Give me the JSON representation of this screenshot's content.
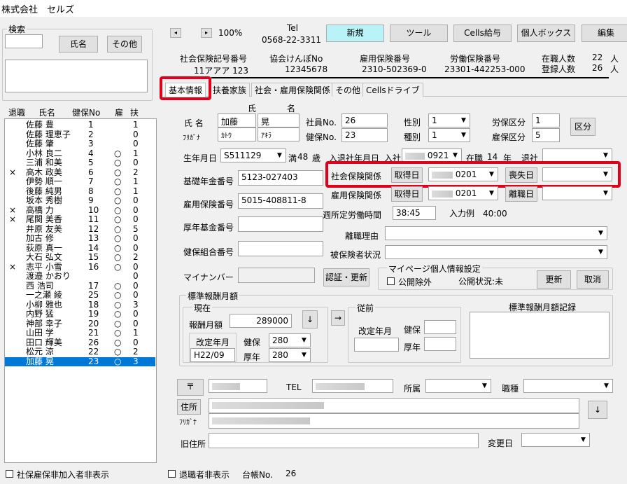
{
  "window": {
    "title": "株式会社　セルズ"
  },
  "search": {
    "group_label": "検索",
    "btn_name": "氏名",
    "btn_other": "その他"
  },
  "list": {
    "headers": {
      "retired": "退職",
      "name": "氏名",
      "no": "健保No",
      "employ": "雇",
      "dependents": "扶"
    },
    "rows": [
      {
        "retired": "",
        "name": "佐藤 豊",
        "no": "1",
        "employ": "",
        "dep": "1"
      },
      {
        "retired": "",
        "name": "佐藤 理恵子",
        "no": "2",
        "employ": "",
        "dep": "0"
      },
      {
        "retired": "",
        "name": "佐藤 肇",
        "no": "3",
        "employ": "",
        "dep": "0"
      },
      {
        "retired": "",
        "name": "小林 良二",
        "no": "4",
        "employ": "○",
        "dep": "1"
      },
      {
        "retired": "",
        "name": "三浦 和美",
        "no": "5",
        "employ": "○",
        "dep": "0"
      },
      {
        "retired": "×",
        "name": "高木 政美",
        "no": "6",
        "employ": "○",
        "dep": "2"
      },
      {
        "retired": "",
        "name": "伊勢 順一",
        "no": "7",
        "employ": "○",
        "dep": "1"
      },
      {
        "retired": "",
        "name": "後藤 純男",
        "no": "8",
        "employ": "○",
        "dep": "1"
      },
      {
        "retired": "",
        "name": "坂本 秀樹",
        "no": "9",
        "employ": "○",
        "dep": "0"
      },
      {
        "retired": "×",
        "name": "高橋 力",
        "no": "10",
        "employ": "○",
        "dep": "0"
      },
      {
        "retired": "×",
        "name": "尾関 美香",
        "no": "11",
        "employ": "○",
        "dep": "0"
      },
      {
        "retired": "",
        "name": "井原 友美",
        "no": "12",
        "employ": "○",
        "dep": "5"
      },
      {
        "retired": "",
        "name": "加古 修",
        "no": "13",
        "employ": "○",
        "dep": "0"
      },
      {
        "retired": "",
        "name": "荻原 真一",
        "no": "14",
        "employ": "○",
        "dep": "0"
      },
      {
        "retired": "",
        "name": "大石 弘文",
        "no": "15",
        "employ": "○",
        "dep": "2"
      },
      {
        "retired": "×",
        "name": "志平 小雪",
        "no": "16",
        "employ": "○",
        "dep": "0"
      },
      {
        "retired": "",
        "name": "渡邉 かおり",
        "no": "",
        "employ": "",
        "dep": "0"
      },
      {
        "retired": "",
        "name": "西 浩司",
        "no": "17",
        "employ": "○",
        "dep": "0"
      },
      {
        "retired": "",
        "name": "一之瀬 綾",
        "no": "25",
        "employ": "○",
        "dep": "0"
      },
      {
        "retired": "",
        "name": "小柳 雅也",
        "no": "18",
        "employ": "○",
        "dep": "3"
      },
      {
        "retired": "",
        "name": "内野 猛",
        "no": "19",
        "employ": "○",
        "dep": "0"
      },
      {
        "retired": "",
        "name": "神部 幸子",
        "no": "20",
        "employ": "○",
        "dep": "0"
      },
      {
        "retired": "",
        "name": "山田 学",
        "no": "21",
        "employ": "○",
        "dep": "1"
      },
      {
        "retired": "",
        "name": "田口 輝美",
        "no": "26",
        "employ": "○",
        "dep": "0"
      },
      {
        "retired": "",
        "name": "松元 涼",
        "no": "22",
        "employ": "○",
        "dep": "2"
      },
      {
        "retired": "",
        "name": "加藤 晃",
        "no": "23",
        "employ": "○",
        "dep": "3",
        "selected": true
      }
    ]
  },
  "bottom": {
    "hide_unenrolled": "社保雇保非加入者非表示",
    "hide_retired": "退職者非表示",
    "ledger_label": "台帳No.",
    "ledger_no": "26"
  },
  "toolbar": {
    "zoom": "100%",
    "tel_label": "Tel",
    "tel": "0568-22-3311",
    "new": "新規",
    "tool": "ツール",
    "cells_pay": "Cells給与",
    "personal_box": "個人ボックス",
    "edit": "編集"
  },
  "header": {
    "sh_label": "社会保険記号番号",
    "sh_value": "11アアア 123",
    "kyokai_label": "協会けんぽNo",
    "kyokai_value": "12345678",
    "koyo_label": "雇用保険番号",
    "koyo_value": "2310-502369-0",
    "rodo_label": "労働保険番号",
    "rodo_value": "23301-442253-000",
    "zaishoku_label": "在職人数",
    "zaishoku_value": "22",
    "toroku_label": "登録人数",
    "toroku_value": "26",
    "unit": "人"
  },
  "tabs": [
    "基本情報",
    "扶養家族",
    "社会・雇用保険関係",
    "その他",
    "Cellsドライブ"
  ],
  "form": {
    "shi": "氏",
    "mei": "名",
    "name_label": "氏 名",
    "furigana_label": "ﾌﾘｶﾞﾅ",
    "last_name": "加藤",
    "first_name": "晃",
    "last_kana": "ｶﾄｳ",
    "first_kana": "ｱｷﾗ",
    "emp_no_label": "社員No.",
    "emp_no": "26",
    "kenpo_no_label": "健保No.",
    "kenpo_no": "23",
    "gender_label": "性別",
    "gender": "1",
    "type_label": "種別",
    "type": "1",
    "rodo_kubun_label": "労保区分",
    "rodo_kubun": "1",
    "koyo_kubun_label": "雇保区分",
    "koyo_kubun": "5",
    "kubun_btn": "区分",
    "birth_label": "生年月日",
    "birth": "S511129",
    "age_prefix": "満",
    "age": "48",
    "age_suffix": "歳",
    "join_label": "入退社年月日",
    "join_in": "入社",
    "join_date": "0921",
    "tenure_label": "在職",
    "tenure": "14",
    "tenure_unit": "年",
    "retire_label": "退社",
    "pension_label": "基礎年金番号",
    "pension": "5123-027403",
    "shaho_label": "社会保険関係",
    "get_btn": "取得日",
    "shaho_date": "0201",
    "lose_btn": "喪失日",
    "koyo_label": "雇用保険番号",
    "koyo": "5015-408811-8",
    "koyo_rel_label": "雇用保険関係",
    "koyo_date": "0201",
    "leave_btn": "離職日",
    "hours_label": "週所定労働時間",
    "hours": "38:45",
    "example": "入力例　40:00",
    "kousei_label": "厚年基金番号",
    "rishoku_label": "離職理由",
    "kumiai_label": "健保組合番号",
    "status_label": "被保険者状況",
    "mynumber_label": "マイナンバー",
    "auth_btn": "認証・更新",
    "mypage_label": "マイページ個人情報設定",
    "public_exclude": "公開除外",
    "public_status": "公開状況:未",
    "update_btn": "更新",
    "cancel_btn": "取消"
  },
  "salary": {
    "group_label": "標準報酬月額",
    "current_label": "現在",
    "monthly_label": "報酬月額",
    "monthly": "289000",
    "revised_label": "改定年月",
    "revised": "H22/09",
    "kenpo_label": "健保",
    "kenpo": "280",
    "kounen_label": "厚年",
    "kounen": "280",
    "down_arrow": "↓",
    "right_arrow": "→",
    "prev_label": "従前",
    "prev_revised_label": "改定年月",
    "prev_kenpo": "健保",
    "prev_kounen": "厚年",
    "record_label": "標準報酬月額記録"
  },
  "address": {
    "postal_btn": "〒",
    "tel_label": "TEL",
    "dept_label": "所属",
    "job_label": "職種",
    "addr_btn": "住所",
    "furigana": "ﾌﾘｶﾞﾅ",
    "old_addr_label": "旧住所",
    "change_label": "変更日",
    "down_btn": "↓"
  },
  "colors": {
    "highlight": "#e0001a",
    "selection": "#0078d7",
    "new_button": "#b9f3f7"
  }
}
